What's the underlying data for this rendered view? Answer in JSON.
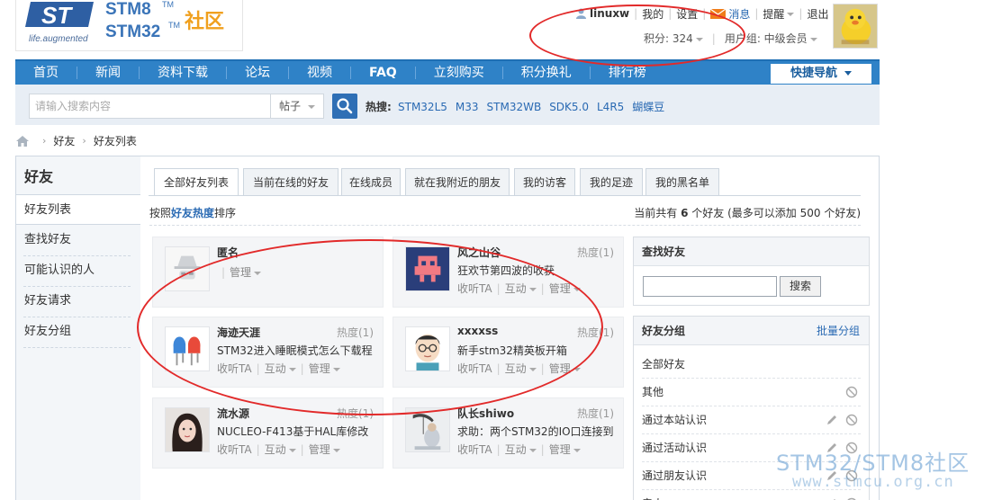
{
  "logo": {
    "tagline": "life.augmented",
    "stm8": "STM8",
    "stm32": "STM32",
    "tm": "TM",
    "community": "社区"
  },
  "user_bar": {
    "username": "linuxw",
    "mine": "我的",
    "settings": "设置",
    "messages": "消息",
    "reminders": "提醒",
    "logout": "退出",
    "points": "积分: 324",
    "user_group": "用户组: 中级会员"
  },
  "nav": {
    "items": [
      "首页",
      "新闻",
      "资料下载",
      "论坛",
      "视频",
      "FAQ",
      "立刻购买",
      "积分换礼",
      "排行榜"
    ],
    "quick_nav": "快捷导航"
  },
  "search": {
    "placeholder": "请输入搜索内容",
    "type": "帖子",
    "hot_label": "热搜:",
    "hot_links": [
      "STM32L5",
      "M33",
      "STM32WB",
      "SDK5.0",
      "L4R5",
      "蝴蝶豆"
    ]
  },
  "breadcrumb": [
    "好友",
    "好友列表"
  ],
  "sidebar": {
    "title": "好友",
    "items": [
      "好友列表",
      "查找好友",
      "可能认识的人",
      "好友请求",
      "好友分组"
    ]
  },
  "tabs": [
    "全部好友列表",
    "当前在线的好友",
    "在线成员",
    "就在我附近的朋友",
    "我的访客",
    "我的足迹",
    "我的黑名单"
  ],
  "sort": {
    "prefix": "按照",
    "key": "好友热度",
    "suffix": "排序"
  },
  "count": {
    "prefix": "当前共有 ",
    "num": "6",
    "suffix": " 个好友 (最多可以添加 500 个好友)"
  },
  "friends": [
    {
      "name": "匿名",
      "heat": "",
      "desc": "",
      "listen": "",
      "interact": "",
      "manage": "管理"
    },
    {
      "name": "风之山谷",
      "heat": "热度(1)",
      "desc": "狂欢节第四波的收获",
      "listen": "收听TA",
      "interact": "互动",
      "manage": "管理"
    },
    {
      "name": "海迹天涯",
      "heat": "热度(1)",
      "desc": "STM32进入睡眠模式怎么下载程",
      "listen": "收听TA",
      "interact": "互动",
      "manage": "管理"
    },
    {
      "name": "xxxxss",
      "heat": "热度(1)",
      "desc": "新手stm32精英板开箱",
      "listen": "收听TA",
      "interact": "互动",
      "manage": "管理"
    },
    {
      "name": "流水源",
      "heat": "热度(1)",
      "desc": "NUCLEO-F413基于HAL库修改",
      "listen": "收听TA",
      "interact": "互动",
      "manage": "管理"
    },
    {
      "name": "队长shiwo",
      "heat": "热度(1)",
      "desc": "求助：两个STM32的IO口连接到",
      "listen": "收听TA",
      "interact": "互动",
      "manage": "管理"
    }
  ],
  "find_panel": {
    "title": "查找好友",
    "button": "搜索"
  },
  "group_panel": {
    "title": "好友分组",
    "batch": "批量分组",
    "items": [
      "全部好友",
      "其他",
      "通过本站认识",
      "通过活动认识",
      "通过朋友认识",
      "亲人"
    ]
  },
  "watermark": {
    "line1": "STM32/STM8社区",
    "line2": "www.stmcu.org.cn"
  },
  "colors": {
    "nav_blue": "#2f82c7",
    "link_blue": "#2a6ab3",
    "annotation_red": "#e22a2a",
    "logo_orange": "#f0a01e"
  }
}
